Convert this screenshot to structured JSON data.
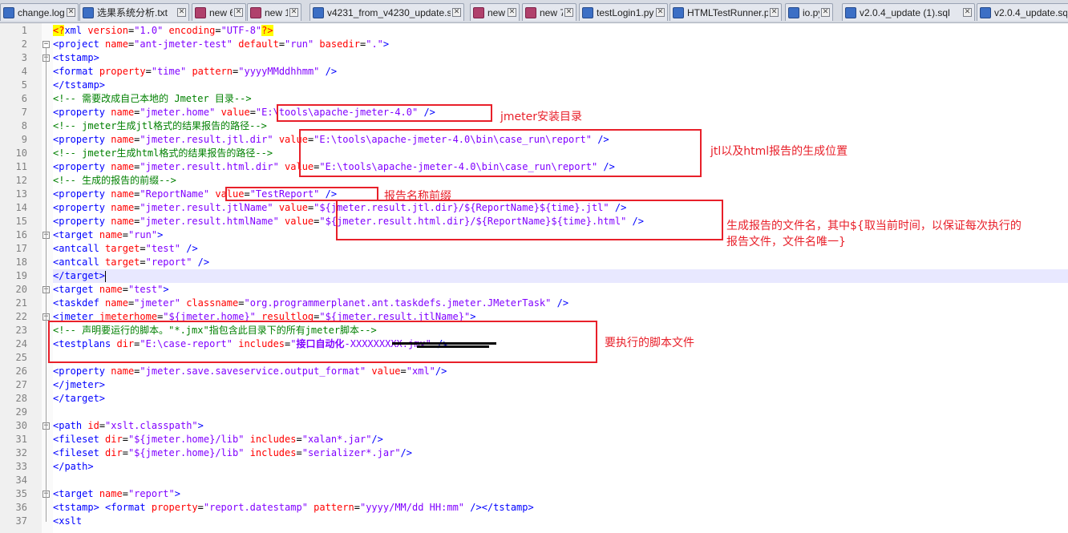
{
  "tabs": [
    {
      "label": "change.log",
      "state": "saved"
    },
    {
      "label": "选果系统分析.txt",
      "state": "saved"
    },
    {
      "label": "new 6",
      "state": "unsaved"
    },
    {
      "label": "new 1",
      "state": "unsaved"
    },
    {
      "label": "v4231_from_v4230_update.sql",
      "state": "saved"
    },
    {
      "label": "new 5",
      "state": "unsaved"
    },
    {
      "label": "new 7",
      "state": "unsaved"
    },
    {
      "label": "testLogin1.py",
      "state": "saved"
    },
    {
      "label": "HTMLTestRunner.py",
      "state": "saved"
    },
    {
      "label": "io.py",
      "state": "saved"
    },
    {
      "label": "v2.0.4_update (1).sql",
      "state": "saved"
    },
    {
      "label": "v2.0.4_update.sql",
      "state": "saved"
    }
  ],
  "colors": {
    "tag": "#0000ff",
    "attribute": "#ff0000",
    "value": "#8000ff",
    "comment": "#008000",
    "annotation": "#e8202a"
  },
  "lines": [
    [
      [
        "pi",
        "<?"
      ],
      [
        "tag",
        "xml"
      ],
      [
        "t",
        " "
      ],
      [
        "attr",
        "version"
      ],
      [
        "t",
        "="
      ],
      [
        "val",
        "\"1.0\""
      ],
      [
        "t",
        " "
      ],
      [
        "attr",
        "encoding"
      ],
      [
        "t",
        "="
      ],
      [
        "val",
        "\"UTF-8\""
      ],
      [
        "pi",
        "?>"
      ]
    ],
    [
      [
        "tag",
        "<project"
      ],
      [
        "t",
        " "
      ],
      [
        "attr",
        "name"
      ],
      [
        "t",
        "="
      ],
      [
        "val",
        "\"ant-jmeter-test\""
      ],
      [
        "t",
        " "
      ],
      [
        "attr",
        "default"
      ],
      [
        "t",
        "="
      ],
      [
        "val",
        "\"run\""
      ],
      [
        "t",
        " "
      ],
      [
        "attr",
        "basedir"
      ],
      [
        "t",
        "="
      ],
      [
        "val",
        "\".\""
      ],
      [
        "tag",
        ">"
      ]
    ],
    [
      [
        "tag",
        "<tstamp>"
      ]
    ],
    [
      [
        "tag",
        "<format"
      ],
      [
        "t",
        " "
      ],
      [
        "attr",
        "property"
      ],
      [
        "t",
        "="
      ],
      [
        "val",
        "\"time\""
      ],
      [
        "t",
        " "
      ],
      [
        "attr",
        "pattern"
      ],
      [
        "t",
        "="
      ],
      [
        "val",
        "\"yyyyMMddhhmm\""
      ],
      [
        "t",
        " "
      ],
      [
        "tag",
        "/>"
      ]
    ],
    [
      [
        "tag",
        "</tstamp>"
      ]
    ],
    [
      [
        "cmt",
        "<!-- 需要改成自己本地的 Jmeter 目录-->"
      ]
    ],
    [
      [
        "tag",
        "<property"
      ],
      [
        "t",
        " "
      ],
      [
        "attr",
        "name"
      ],
      [
        "t",
        "="
      ],
      [
        "val",
        "\"jmeter.home\""
      ],
      [
        "t",
        " "
      ],
      [
        "attr",
        "value"
      ],
      [
        "t",
        "="
      ],
      [
        "val",
        "\"E:\\tools\\apache-jmeter-4.0\""
      ],
      [
        "t",
        " "
      ],
      [
        "tag",
        "/>"
      ]
    ],
    [
      [
        "cmt",
        "<!-- jmeter生成jtl格式的结果报告的路径-->"
      ]
    ],
    [
      [
        "tag",
        "<property"
      ],
      [
        "t",
        " "
      ],
      [
        "attr",
        "name"
      ],
      [
        "t",
        "="
      ],
      [
        "val",
        "\"jmeter.result.jtl.dir\""
      ],
      [
        "t",
        " "
      ],
      [
        "attr",
        "value"
      ],
      [
        "t",
        "="
      ],
      [
        "val",
        "\"E:\\tools\\apache-jmeter-4.0\\bin\\case_run\\report\""
      ],
      [
        "t",
        " "
      ],
      [
        "tag",
        "/>"
      ]
    ],
    [
      [
        "cmt",
        "<!-- jmeter生成html格式的结果报告的路径-->"
      ]
    ],
    [
      [
        "tag",
        "<property"
      ],
      [
        "t",
        " "
      ],
      [
        "attr",
        "name"
      ],
      [
        "t",
        "="
      ],
      [
        "val",
        "\"jmeter.result.html.dir\""
      ],
      [
        "t",
        " "
      ],
      [
        "attr",
        "value"
      ],
      [
        "t",
        "="
      ],
      [
        "val",
        "\"E:\\tools\\apache-jmeter-4.0\\bin\\case_run\\report\""
      ],
      [
        "t",
        " "
      ],
      [
        "tag",
        "/>"
      ]
    ],
    [
      [
        "cmt",
        "<!-- 生成的报告的前缀-->"
      ]
    ],
    [
      [
        "tag",
        "<property"
      ],
      [
        "t",
        " "
      ],
      [
        "attr",
        "name"
      ],
      [
        "t",
        "="
      ],
      [
        "val",
        "\"ReportName\""
      ],
      [
        "t",
        " "
      ],
      [
        "attr",
        "value"
      ],
      [
        "t",
        "="
      ],
      [
        "val",
        "\"TestReport\""
      ],
      [
        "t",
        " "
      ],
      [
        "tag",
        "/>"
      ]
    ],
    [
      [
        "tag",
        "<property"
      ],
      [
        "t",
        " "
      ],
      [
        "attr",
        "name"
      ],
      [
        "t",
        "="
      ],
      [
        "val",
        "\"jmeter.result.jtlName\""
      ],
      [
        "t",
        " "
      ],
      [
        "attr",
        "value"
      ],
      [
        "t",
        "="
      ],
      [
        "val",
        "\"${jmeter.result.jtl.dir}/${ReportName}${time}.jtl\""
      ],
      [
        "t",
        " "
      ],
      [
        "tag",
        "/>"
      ]
    ],
    [
      [
        "tag",
        "<property"
      ],
      [
        "t",
        " "
      ],
      [
        "attr",
        "name"
      ],
      [
        "t",
        "="
      ],
      [
        "val",
        "\"jmeter.result.htmlName\""
      ],
      [
        "t",
        " "
      ],
      [
        "attr",
        "value"
      ],
      [
        "t",
        "="
      ],
      [
        "val",
        "\"${jmeter.result.html.dir}/${ReportName}${time}.html\""
      ],
      [
        "t",
        " "
      ],
      [
        "tag",
        "/>"
      ]
    ],
    [
      [
        "tag",
        "<target"
      ],
      [
        "t",
        " "
      ],
      [
        "attr",
        "name"
      ],
      [
        "t",
        "="
      ],
      [
        "val",
        "\"run\""
      ],
      [
        "tag",
        ">"
      ]
    ],
    [
      [
        "tag",
        "<antcall"
      ],
      [
        "t",
        " "
      ],
      [
        "attr",
        "target"
      ],
      [
        "t",
        "="
      ],
      [
        "val",
        "\"test\""
      ],
      [
        "t",
        " "
      ],
      [
        "tag",
        "/>"
      ]
    ],
    [
      [
        "tag",
        "<antcall"
      ],
      [
        "t",
        " "
      ],
      [
        "attr",
        "target"
      ],
      [
        "t",
        "="
      ],
      [
        "val",
        "\"report\""
      ],
      [
        "t",
        " "
      ],
      [
        "tag",
        "/>"
      ]
    ],
    [
      [
        "tag",
        "</target>"
      ],
      [
        "caret",
        ""
      ]
    ],
    [
      [
        "tag",
        "<target"
      ],
      [
        "t",
        " "
      ],
      [
        "attr",
        "name"
      ],
      [
        "t",
        "="
      ],
      [
        "val",
        "\"test\""
      ],
      [
        "tag",
        ">"
      ]
    ],
    [
      [
        "tag",
        "<taskdef"
      ],
      [
        "t",
        " "
      ],
      [
        "attr",
        "name"
      ],
      [
        "t",
        "="
      ],
      [
        "val",
        "\"jmeter\""
      ],
      [
        "t",
        " "
      ],
      [
        "attr",
        "classname"
      ],
      [
        "t",
        "="
      ],
      [
        "val",
        "\"org.programmerplanet.ant.taskdefs.jmeter.JMeterTask\""
      ],
      [
        "t",
        " "
      ],
      [
        "tag",
        "/>"
      ]
    ],
    [
      [
        "tag",
        "<jmeter"
      ],
      [
        "t",
        " "
      ],
      [
        "attr",
        "jmeterhome"
      ],
      [
        "t",
        "="
      ],
      [
        "val",
        "\"${jmeter.home}\""
      ],
      [
        "t",
        " "
      ],
      [
        "attr",
        "resultlog"
      ],
      [
        "t",
        "="
      ],
      [
        "val",
        "\"${jmeter.result.jtlName}\""
      ],
      [
        "tag",
        ">"
      ]
    ],
    [
      [
        "cmt",
        "<!-- 声明要运行的脚本。\"*.jmx\"指包含此目录下的所有jmeter脚本-->"
      ]
    ],
    [
      [
        "tag",
        "<testplans"
      ],
      [
        "t",
        " "
      ],
      [
        "attr",
        "dir"
      ],
      [
        "t",
        "="
      ],
      [
        "val",
        "\"E:\\case-report\""
      ],
      [
        "t",
        " "
      ],
      [
        "attr",
        "includes"
      ],
      [
        "t",
        "="
      ],
      [
        "val",
        "\""
      ],
      [
        "bold",
        "接口自动化"
      ],
      [
        "val",
        "-XXXXXXXXX.jmx\""
      ],
      [
        "t",
        " "
      ],
      [
        "tag",
        "/>"
      ]
    ],
    [],
    [
      [
        "tag",
        "<property"
      ],
      [
        "t",
        " "
      ],
      [
        "attr",
        "name"
      ],
      [
        "t",
        "="
      ],
      [
        "val",
        "\"jmeter.save.saveservice.output_format\""
      ],
      [
        "t",
        " "
      ],
      [
        "attr",
        "value"
      ],
      [
        "t",
        "="
      ],
      [
        "val",
        "\"xml\""
      ],
      [
        "tag",
        "/>"
      ]
    ],
    [
      [
        "tag",
        "</jmeter>"
      ]
    ],
    [
      [
        "tag",
        "</target>"
      ]
    ],
    [],
    [
      [
        "tag",
        "<path"
      ],
      [
        "t",
        " "
      ],
      [
        "attr",
        "id"
      ],
      [
        "t",
        "="
      ],
      [
        "val",
        "\"xslt.classpath\""
      ],
      [
        "tag",
        ">"
      ]
    ],
    [
      [
        "tag",
        "<fileset"
      ],
      [
        "t",
        " "
      ],
      [
        "attr",
        "dir"
      ],
      [
        "t",
        "="
      ],
      [
        "val",
        "\"${jmeter.home}/lib\""
      ],
      [
        "t",
        " "
      ],
      [
        "attr",
        "includes"
      ],
      [
        "t",
        "="
      ],
      [
        "val",
        "\"xalan*.jar\""
      ],
      [
        "tag",
        "/>"
      ]
    ],
    [
      [
        "tag",
        "<fileset"
      ],
      [
        "t",
        " "
      ],
      [
        "attr",
        "dir"
      ],
      [
        "t",
        "="
      ],
      [
        "val",
        "\"${jmeter.home}/lib\""
      ],
      [
        "t",
        " "
      ],
      [
        "attr",
        "includes"
      ],
      [
        "t",
        "="
      ],
      [
        "val",
        "\"serializer*.jar\""
      ],
      [
        "tag",
        "/>"
      ]
    ],
    [
      [
        "tag",
        "</path>"
      ]
    ],
    [],
    [
      [
        "tag",
        "<target"
      ],
      [
        "t",
        " "
      ],
      [
        "attr",
        "name"
      ],
      [
        "t",
        "="
      ],
      [
        "val",
        "\"report\""
      ],
      [
        "tag",
        ">"
      ]
    ],
    [
      [
        "tag",
        "<tstamp>"
      ],
      [
        "t",
        " "
      ],
      [
        "tag",
        "<format"
      ],
      [
        "t",
        " "
      ],
      [
        "attr",
        "property"
      ],
      [
        "t",
        "="
      ],
      [
        "val",
        "\"report.datestamp\""
      ],
      [
        "t",
        " "
      ],
      [
        "attr",
        "pattern"
      ],
      [
        "t",
        "="
      ],
      [
        "val",
        "\"yyyy/MM/dd HH:mm\""
      ],
      [
        "t",
        " "
      ],
      [
        "tag",
        "/></tstamp>"
      ]
    ],
    [
      [
        "tag",
        "<xslt"
      ]
    ]
  ],
  "annotations": {
    "jmeter_dir": "jmeter安装目录",
    "report_location": "jtl以及html报告的生成位置",
    "report_prefix": "报告名称前缀",
    "report_filename_1": "生成报告的文件名，其中${取当前时间，以保证每次执行的",
    "report_filename_2": "报告文件，文件名唯一}",
    "script_file": "要执行的脚本文件"
  }
}
